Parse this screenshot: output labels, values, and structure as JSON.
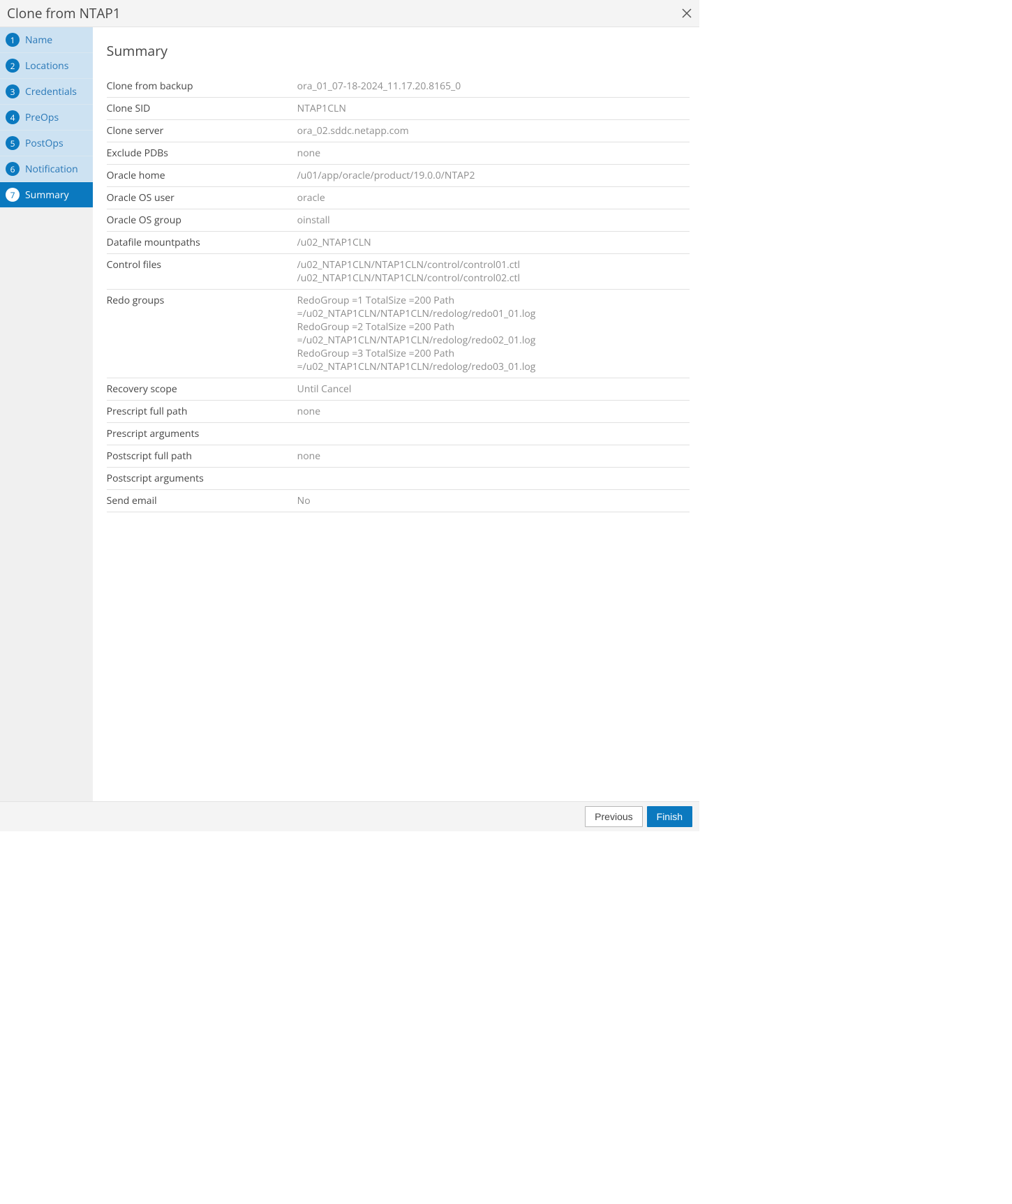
{
  "header": {
    "title": "Clone from NTAP1"
  },
  "sidebar": {
    "steps": [
      {
        "num": "1",
        "label": "Name"
      },
      {
        "num": "2",
        "label": "Locations"
      },
      {
        "num": "3",
        "label": "Credentials"
      },
      {
        "num": "4",
        "label": "PreOps"
      },
      {
        "num": "5",
        "label": "PostOps"
      },
      {
        "num": "6",
        "label": "Notification"
      },
      {
        "num": "7",
        "label": "Summary"
      }
    ]
  },
  "main": {
    "title": "Summary",
    "rows": [
      {
        "label": "Clone from backup",
        "value": "ora_01_07-18-2024_11.17.20.8165_0"
      },
      {
        "label": "Clone SID",
        "value": "NTAP1CLN"
      },
      {
        "label": "Clone server",
        "value": "ora_02.sddc.netapp.com"
      },
      {
        "label": "Exclude PDBs",
        "value": "none"
      },
      {
        "label": "Oracle home",
        "value": "/u01/app/oracle/product/19.0.0/NTAP2"
      },
      {
        "label": "Oracle OS user",
        "value": "oracle"
      },
      {
        "label": "Oracle OS group",
        "value": "oinstall"
      },
      {
        "label": "Datafile mountpaths",
        "value": "/u02_NTAP1CLN"
      },
      {
        "label": "Control files",
        "lines": [
          "/u02_NTAP1CLN/NTAP1CLN/control/control01.ctl",
          "/u02_NTAP1CLN/NTAP1CLN/control/control02.ctl"
        ]
      },
      {
        "label": "Redo groups",
        "lines": [
          "RedoGroup =1 TotalSize =200 Path =/u02_NTAP1CLN/NTAP1CLN/redolog/redo01_01.log",
          "RedoGroup =2 TotalSize =200 Path =/u02_NTAP1CLN/NTAP1CLN/redolog/redo02_01.log",
          "RedoGroup =3 TotalSize =200 Path =/u02_NTAP1CLN/NTAP1CLN/redolog/redo03_01.log"
        ]
      },
      {
        "label": "Recovery scope",
        "value": "Until Cancel"
      },
      {
        "label": "Prescript full path",
        "value": "none"
      },
      {
        "label": "Prescript arguments",
        "value": ""
      },
      {
        "label": "Postscript full path",
        "value": "none"
      },
      {
        "label": "Postscript arguments",
        "value": ""
      },
      {
        "label": "Send email",
        "value": "No"
      }
    ]
  },
  "footer": {
    "previous": "Previous",
    "finish": "Finish"
  }
}
